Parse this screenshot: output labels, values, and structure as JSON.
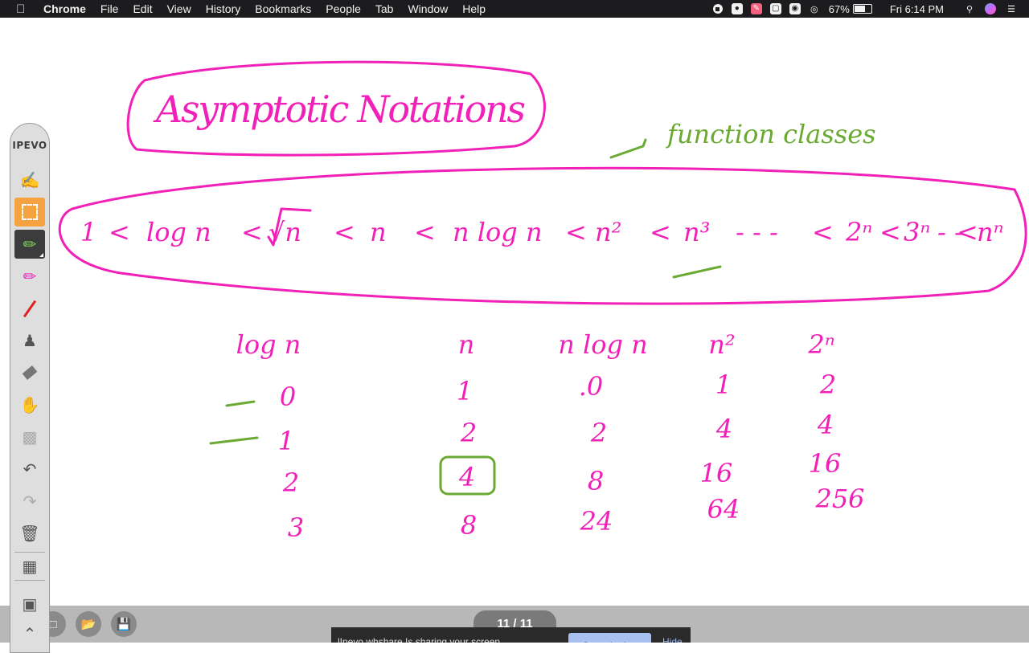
{
  "menubar": {
    "app_name": "Chrome",
    "menus": [
      "File",
      "Edit",
      "View",
      "History",
      "Bookmarks",
      "People",
      "Tab",
      "Window",
      "Help"
    ],
    "battery_percent": "67%",
    "battery_level": 0.67,
    "clock": "Fri 6:14 PM"
  },
  "toolbar": {
    "brand": "IPEVO",
    "tools": [
      {
        "name": "handwriting-tool",
        "icon": "pen-scribble-icon"
      },
      {
        "name": "selection-tool",
        "icon": "selection-icon",
        "active": true
      },
      {
        "name": "pen-tool",
        "icon": "pen-icon"
      },
      {
        "name": "highlighter-tool",
        "icon": "highlighter-icon"
      },
      {
        "name": "line-tool",
        "icon": "line-icon"
      },
      {
        "name": "stamp-tool",
        "icon": "stamp-icon"
      },
      {
        "name": "eraser-tool",
        "icon": "eraser-icon"
      },
      {
        "name": "pan-tool",
        "icon": "hand-icon"
      },
      {
        "name": "toolbox-tool",
        "icon": "toolbox-icon"
      },
      {
        "name": "undo-tool",
        "icon": "undo-icon"
      },
      {
        "name": "redo-tool",
        "icon": "redo-icon"
      },
      {
        "name": "clear-tool",
        "icon": "trash-icon"
      },
      {
        "name": "screen-capture-tool",
        "icon": "capture-icon"
      },
      {
        "name": "camera-tool",
        "icon": "camera-icon"
      }
    ]
  },
  "board": {
    "title": "Asymptotic Notations",
    "annotation": "function classes",
    "order": [
      "1",
      "<",
      "log n",
      "<",
      "√n",
      "<",
      "n",
      "<",
      "n log n",
      "<",
      "n²",
      "<",
      "n³",
      "- - -",
      "<",
      "2ⁿ",
      "<",
      "3ⁿ",
      "- -",
      "<",
      "nⁿ"
    ],
    "table": {
      "headers": [
        "log n",
        "n",
        "n log n",
        "n²",
        "2ⁿ"
      ],
      "columns": [
        [
          "0",
          "1",
          "2",
          "3"
        ],
        [
          "1",
          "2",
          "4",
          "8"
        ],
        [
          ".0",
          "2",
          "8",
          "24"
        ],
        [
          "1",
          "4",
          "16",
          "64"
        ],
        [
          "2",
          "4",
          "16",
          "256"
        ]
      ]
    },
    "colors": {
      "ink_pink": "#f020b8",
      "ink_green": "#6aaa32"
    }
  },
  "bottom": {
    "page_indicator": "11 / 11",
    "notice_text": "lIpevo.whshare.Is sharing your screen.",
    "stop_sharing": "Stop sharing",
    "hide": "Hide"
  }
}
